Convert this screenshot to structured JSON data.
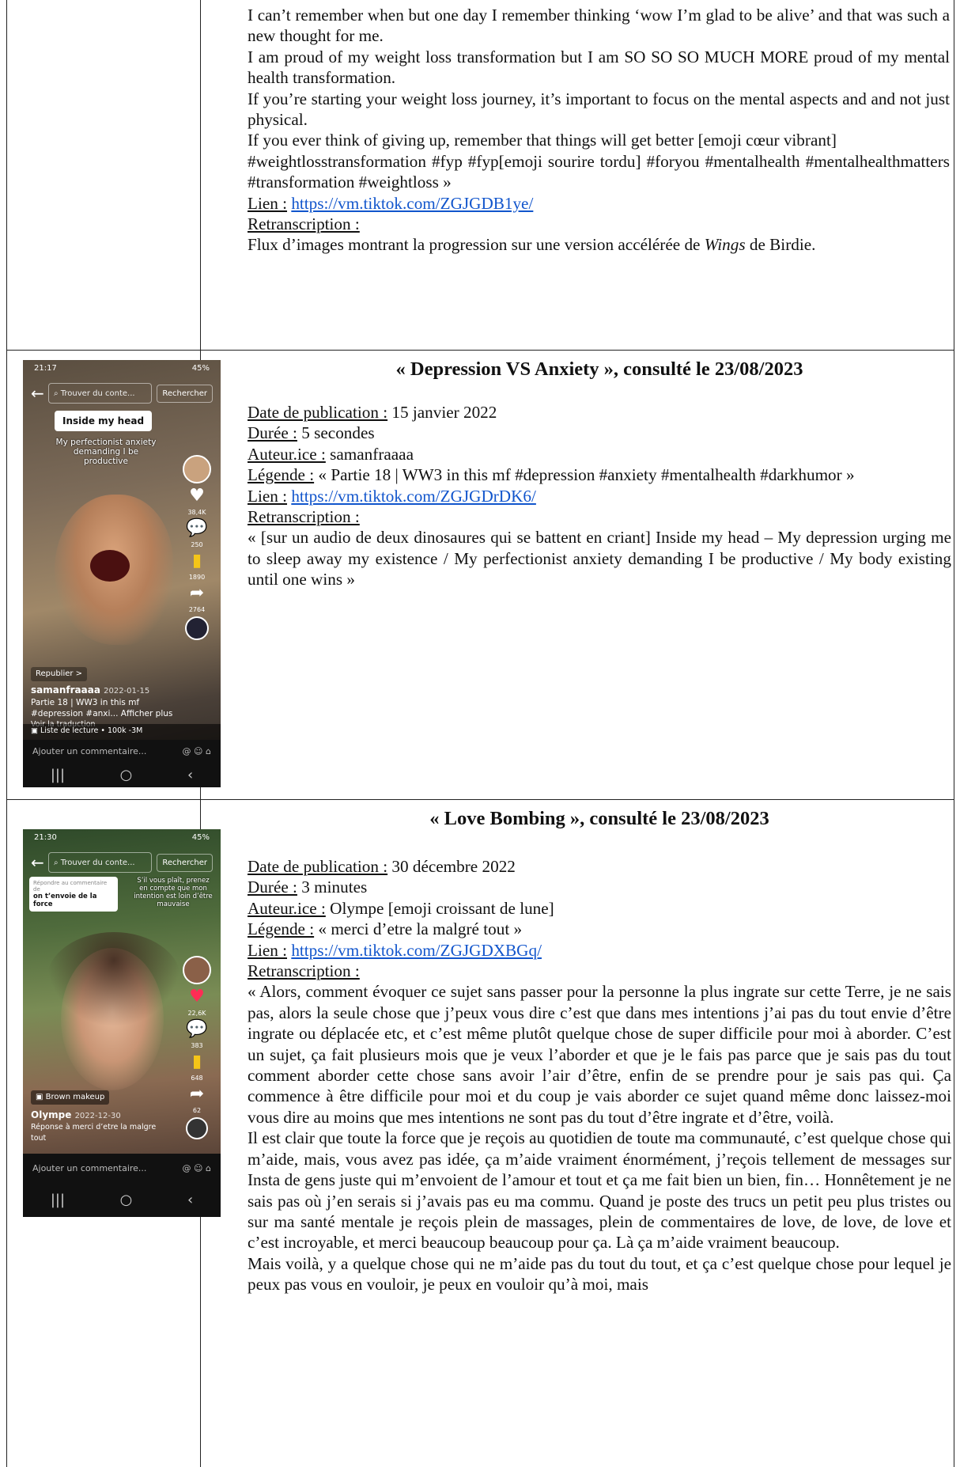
{
  "section1": {
    "paragraphs": [
      "I can’t remember when but one day I remember thinking ‘wow I’m glad to be alive’ and that was such a new thought for me.",
      "I am proud of my weight loss transformation but I am SO SO SO MUCH MORE proud of my mental health transformation.",
      "If you’re starting your weight loss journey, it’s important to focus on the mental aspects and and not just physical.",
      "If you ever think of giving up, remember that things will get better [emoji cœur vibrant]",
      "#weightlosstransformation #fyp #fyp[emoji sourire tordu] #foryou #mentalhealth #mentalhealthmatters #transformation #weightloss »"
    ],
    "lien_label": "Lien :",
    "lien_url": "https://vm.tiktok.com/ZGJGDB1ye/",
    "retranscription_label": "Retranscription :",
    "retranscription_pre": "Flux d’images montrant la progression sur une version accélérée de ",
    "retranscription_em": "Wings",
    "retranscription_post": " de Birdie."
  },
  "section2": {
    "title": "« Depression VS Anxiety », consulté le 23/08/2023",
    "date_label": "Date de publication :",
    "date_value": " 15 janvier 2022",
    "duree_label": "Durée :",
    "duree_value": " 5 secondes",
    "auteur_label": "Auteur.ice :",
    "auteur_value": " samanfraaaa",
    "legende_label": "Légende :",
    "legende_value": " « Partie 18 | WW3 in this mf #depression #anxiety #mentalhealth #darkhumor »",
    "lien_label": "Lien :",
    "lien_url": "https://vm.tiktok.com/ZGJGDrDK6/",
    "retranscription_label": "Retranscription :",
    "retranscription_text": "« [sur un audio de deux dinosaures qui se battent en criant] Inside my head – My depression urging me to sleep away my existence / My perfectionist anxiety demanding I be productive / My body existing until one wins »",
    "phone": {
      "time": "21:17",
      "status": "45%",
      "search_placeholder": "Trouver du conte...",
      "search_button": "Rechercher",
      "sticker": "Inside my head",
      "overlay_text": "My perfectionist anxiety demanding I be productive",
      "likes": "38,4K",
      "comments": "250",
      "saves": "1890",
      "shares": "2764",
      "republish": "Republier >",
      "username": "samanfraaaa",
      "post_date": "2022-01-15",
      "caption": "Partie 18 | WW3 in this mf #depression #anxi... Afficher plus",
      "translation": "Voir la traduction",
      "playlist": "Liste de lecture • 100k -3M",
      "comment_placeholder": "Ajouter un commentaire..."
    }
  },
  "section3": {
    "title": "« Love Bombing », consulté le 23/08/2023",
    "date_label": "Date de publication :",
    "date_value": " 30 décembre 2022",
    "duree_label": "Durée :",
    "duree_value": " 3 minutes",
    "auteur_label": "Auteur.ice :",
    "auteur_value": " Olympe [emoji croissant de lune]",
    "legende_label": "Légende :",
    "legende_value": " « merci d’etre la malgré tout »",
    "lien_label": "Lien :",
    "lien_url": "https://vm.tiktok.com/ZGJGDXBGq/",
    "retranscription_label": "Retranscription :",
    "paragraphs": [
      "« Alors, comment évoquer ce sujet sans passer pour la personne la plus ingrate sur cette Terre, je ne sais pas, alors la seule chose que j’peux vous dire c’est que dans mes intentions j’ai pas du tout envie d’être ingrate ou déplacée etc, et c’est même plutôt quelque chose de super difficile pour moi à aborder. C’est un sujet, ça fait plusieurs mois que je veux l’aborder et que je le fais pas parce que je sais pas du tout comment aborder cette chose sans avoir l’air d’être, enfin de se prendre pour je sais pas qui. Ça commence à être difficile pour moi et du coup je vais aborder ce sujet quand même donc laissez-moi vous dire au moins que mes intentions ne sont pas du tout d’être ingrate et d’être, voilà.",
      "Il est clair que toute la force que je reçois au quotidien de toute ma communauté, c’est quelque chose qui m’aide, mais, vous avez pas idée, ça m’aide vraiment énormément, j’reçois tellement de messages sur Insta de gens juste qui m’envoient de l’amour et tout et ça me fait bien un bien, fin… Honnêtement je ne sais pas où j’en serais si j’avais pas eu ma commu. Quand je poste des trucs un petit peu plus tristes ou sur ma santé mentale je reçois plein de massages, plein de commentaires de love, de love, de love et c’est incroyable, et merci beaucoup beaucoup pour ça. Là ça m’aide vraiment beaucoup.",
      "Mais voilà, y a quelque chose qui ne m’aide pas du tout du tout, et ça c’est quelque chose pour lequel je peux pas vous en vouloir, je peux en vouloir qu’à moi, mais"
    ],
    "phone": {
      "time": "21:30",
      "status": "45%",
      "search_placeholder": "Trouver du conte...",
      "search_button": "Rechercher",
      "reply_hint": "Répondre au commentaire de",
      "reply_comment": "on t’envoie de la force",
      "overlay_text": "S’il vous plaît, prenez en compte que mon intention est loin d’être mauvaise",
      "likes": "22,6K",
      "comments": "383",
      "saves": "648",
      "shares": "62",
      "tag": "Brown makeup",
      "username": "Olympe",
      "post_date": "2022-12-30",
      "caption": "Réponse à merci d’etre la malgre tout",
      "comment_placeholder": "Ajouter un commentaire..."
    }
  }
}
